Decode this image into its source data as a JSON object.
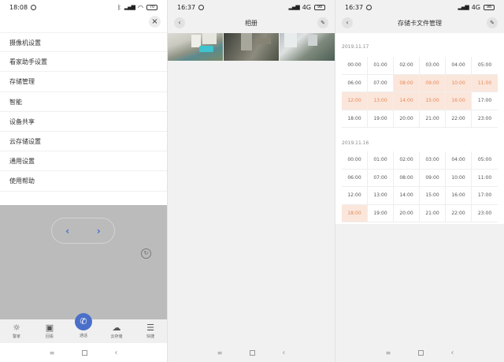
{
  "screen1": {
    "status": {
      "time": "18:08",
      "battery": "70"
    },
    "close_symbol": "×",
    "menu": [
      {
        "label": "摄像机设置"
      },
      {
        "label": "看家助手设置"
      },
      {
        "label": "存储管理"
      },
      {
        "label": "智能"
      },
      {
        "label": "设备共享"
      },
      {
        "label": "云存储设置"
      },
      {
        "label": "通用设置"
      },
      {
        "label": "使用帮助"
      }
    ],
    "ptz": {
      "left_icon": "chevron-left-icon",
      "right_icon": "chevron-right-icon"
    },
    "tabs": [
      {
        "label": "警家",
        "icon": "alarm-light-icon"
      },
      {
        "label": "回看",
        "icon": "playback-icon"
      },
      {
        "label": "通话",
        "icon": "phone-icon"
      },
      {
        "label": "云存储",
        "icon": "cloud-icon"
      },
      {
        "label": "快捷",
        "icon": "menu-icon"
      }
    ]
  },
  "screen2": {
    "status": {
      "time": "16:37",
      "network": "4G",
      "battery": "98"
    },
    "title": "相册",
    "thumbnails": [
      {
        "icon": "photo-thumbnail"
      },
      {
        "icon": "photo-thumbnail"
      },
      {
        "icon": "photo-thumbnail"
      }
    ]
  },
  "screen3": {
    "status": {
      "time": "16:37",
      "network": "4G",
      "battery": "98"
    },
    "title": "存储卡文件管理",
    "days": [
      {
        "date": "2019.11.17",
        "hours": [
          "00:00",
          "01:00",
          "02:00",
          "03:00",
          "04:00",
          "05:00",
          "06:00",
          "07:00",
          "08:00",
          "09:00",
          "10:00",
          "11:00",
          "12:00",
          "13:00",
          "14:00",
          "15:00",
          "16:00",
          "17:00",
          "18:00",
          "19:00",
          "20:00",
          "21:00",
          "22:00",
          "23:00"
        ],
        "recorded": [
          "08:00",
          "09:00",
          "10:00",
          "11:00",
          "12:00",
          "13:00",
          "14:00",
          "15:00",
          "16:00"
        ]
      },
      {
        "date": "2019.11.16",
        "hours": [
          "00:00",
          "01:00",
          "02:00",
          "03:00",
          "04:00",
          "05:00",
          "06:00",
          "07:00",
          "08:00",
          "09:00",
          "10:00",
          "11:00",
          "12:00",
          "13:00",
          "14:00",
          "15:00",
          "16:00",
          "17:00",
          "18:00",
          "19:00",
          "20:00",
          "21:00",
          "22:00",
          "23:00"
        ],
        "recorded": [
          "18:00"
        ]
      }
    ]
  },
  "colors": {
    "accent": "#4a6fc9",
    "recorded_bg": "#fbe6dc",
    "recorded_text": "#e58a55",
    "overlay": "#bbbbbb"
  }
}
